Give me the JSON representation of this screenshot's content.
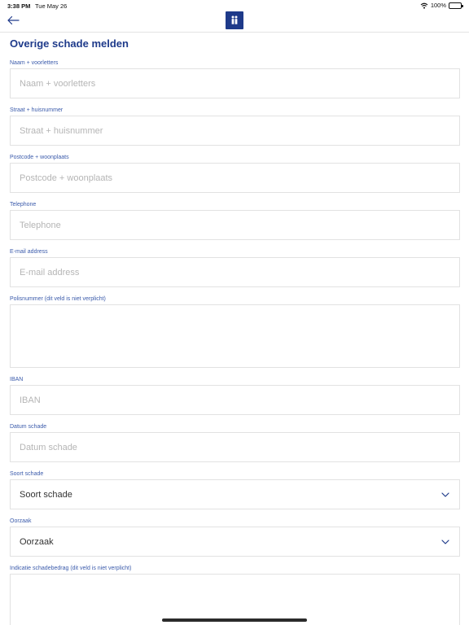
{
  "status_bar": {
    "time": "3:38 PM",
    "date": "Tue May 26",
    "battery": "100%",
    "battery_level": 1.0
  },
  "nav": {
    "back_icon": "back-arrow-icon",
    "logo_icon": "logo-icon"
  },
  "page": {
    "title": "Overige schade melden"
  },
  "form": {
    "naam": {
      "label": "Naam + voorletters",
      "placeholder": "Naam + voorletters",
      "value": ""
    },
    "straat": {
      "label": "Straat + huisnummer",
      "placeholder": "Straat + huisnummer",
      "value": ""
    },
    "postcode": {
      "label": "Postcode + woonplaats",
      "placeholder": "Postcode + woonplaats",
      "value": ""
    },
    "telephone": {
      "label": "Telephone",
      "placeholder": "Telephone",
      "value": ""
    },
    "email": {
      "label": "E-mail address",
      "placeholder": "E-mail address",
      "value": ""
    },
    "polisnummer": {
      "label": "Polisnummer (dit veld is niet verplicht)",
      "placeholder": "",
      "value": ""
    },
    "iban": {
      "label": "IBAN",
      "placeholder": "IBAN",
      "value": ""
    },
    "datum": {
      "label": "Datum schade",
      "placeholder": "Datum schade",
      "value": ""
    },
    "soort": {
      "label": "Soort schade",
      "value": "Soort schade"
    },
    "oorzaak": {
      "label": "Oorzaak",
      "value": "Oorzaak"
    },
    "indicatie": {
      "label": "Indicatie schadebedrag (dit veld is niet verplicht)",
      "placeholder": "",
      "value": ""
    }
  },
  "colors": {
    "accent": "#1e3a8a",
    "label": "#3b5bab",
    "border": "#e2e2e2",
    "placeholder": "#b5b5b5"
  }
}
